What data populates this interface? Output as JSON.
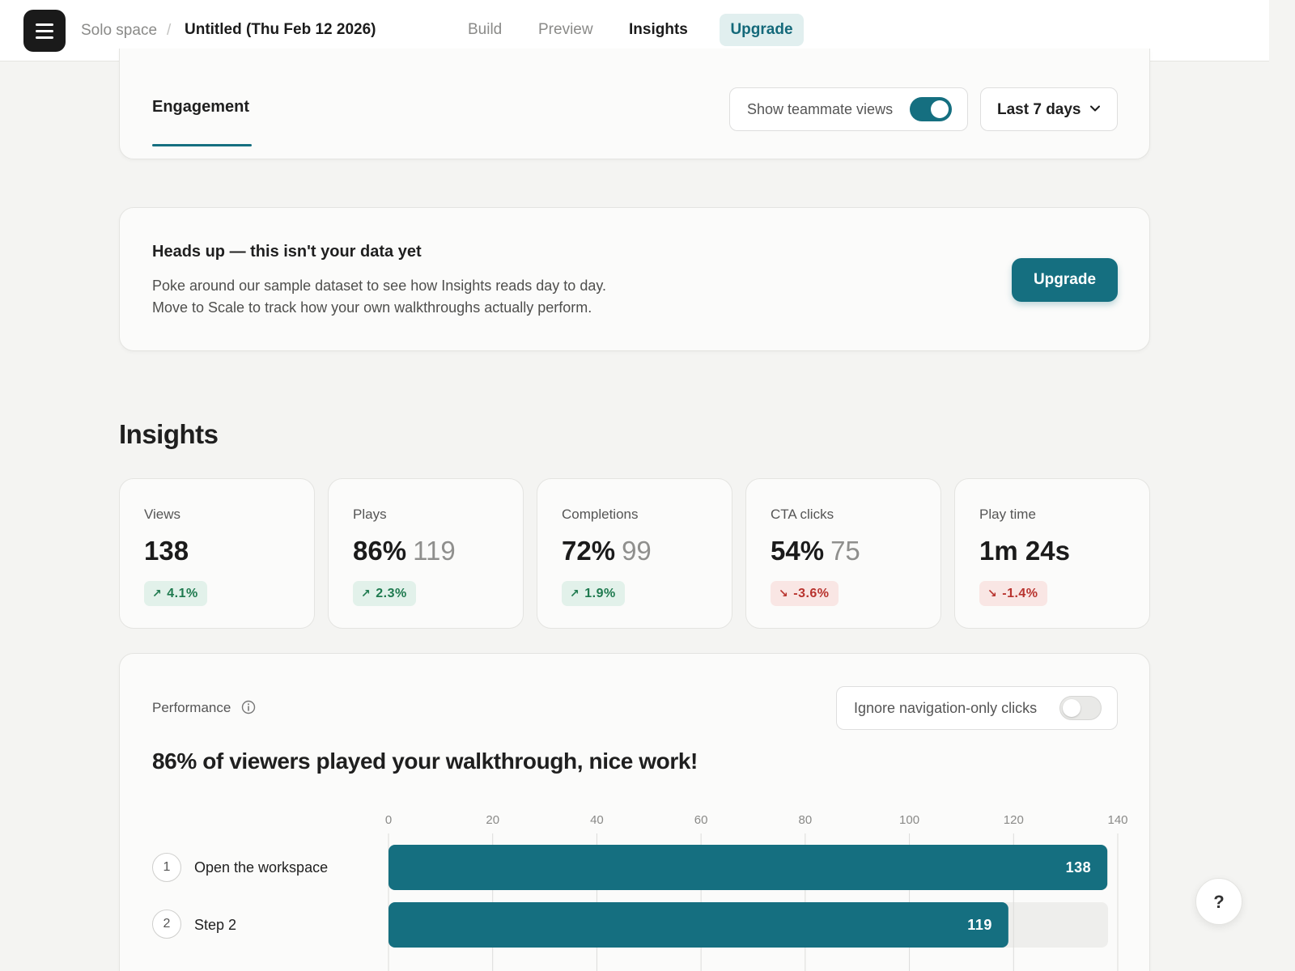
{
  "topbar": {
    "breadcrumb_space": "Solo space",
    "breadcrumb_sep": "/",
    "walkthrough_title": "Untitled (Thu Feb 12 2026)",
    "tabs": [
      {
        "label": "Build"
      },
      {
        "label": "Preview"
      },
      {
        "label": "Insights",
        "active": true
      }
    ],
    "upgrade_label": "Upgrade"
  },
  "engagement": {
    "tab_label": "Engagement",
    "teammate_toggle_label": "Show teammate views",
    "teammate_toggle_on": true,
    "range_label": "Last 7 days"
  },
  "notice": {
    "title": "Heads up — this isn't your data yet",
    "line1": "Poke around our sample dataset to see how Insights reads day to day.",
    "line2": "Move to Scale to track how your own walkthroughs actually perform.",
    "button_label": "Upgrade"
  },
  "insights": {
    "heading": "Insights",
    "metrics": [
      {
        "label": "Views",
        "value": "138",
        "sub": "",
        "delta": "4.1%",
        "trend": "up"
      },
      {
        "label": "Plays",
        "value": "86%",
        "sub": "119",
        "delta": "2.3%",
        "trend": "up"
      },
      {
        "label": "Completions",
        "value": "72%",
        "sub": "99",
        "delta": "1.9%",
        "trend": "up"
      },
      {
        "label": "CTA clicks",
        "value": "54%",
        "sub": "75",
        "delta": "-3.6%",
        "trend": "down"
      },
      {
        "label": "Play time",
        "value": "1m 24s",
        "sub": "",
        "delta": "-1.4%",
        "trend": "down"
      }
    ]
  },
  "performance": {
    "label": "Performance",
    "ignore_toggle_label": "Ignore navigation-only clicks",
    "ignore_toggle_on": false,
    "headline": "86% of viewers played your walkthrough, nice work!"
  },
  "colors": {
    "accent": "#156f80",
    "bar_track": "#eeeeec",
    "up": "#1f7a4f",
    "down": "#b8332e"
  },
  "help_label": "?",
  "chart_data": {
    "type": "bar",
    "orientation": "horizontal",
    "xlim": [
      0,
      140
    ],
    "xticks": [
      0,
      20,
      40,
      60,
      80,
      100,
      120,
      140
    ],
    "categories": [
      {
        "num": "1",
        "name": "Open the workspace"
      },
      {
        "num": "2",
        "name": "Step 2"
      }
    ],
    "values": [
      138,
      119
    ],
    "grid": true
  }
}
